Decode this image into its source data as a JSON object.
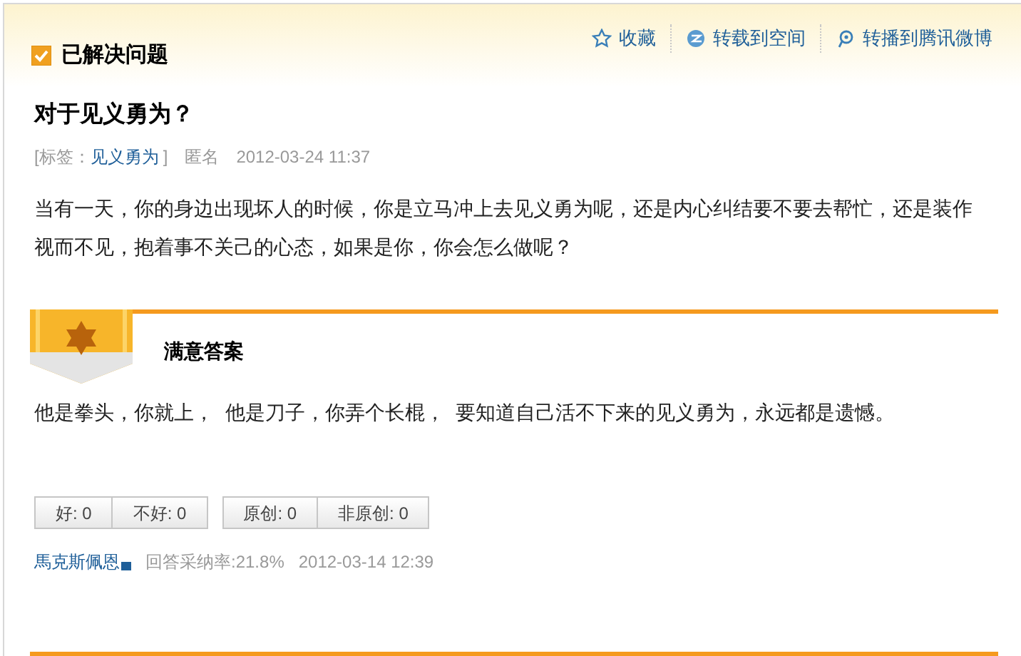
{
  "header": {
    "status_label": "已解决问题",
    "checked": true
  },
  "actions": [
    {
      "kind": "star",
      "label": "收藏"
    },
    {
      "kind": "share",
      "label": "转载到空间"
    },
    {
      "kind": "weibo",
      "label": "转播到腾讯微博"
    }
  ],
  "question": {
    "title": "对于见义勇为？",
    "tag_prefix": "[标签：",
    "tag": "见义勇为",
    "tag_suffix": "]",
    "author": "匿名",
    "time": "2012-03-24 11:37",
    "body": "当有一天，你的身边出现坏人的时候，你是立马冲上去见义勇为呢，还是内心纠结要不要去帮忙，还是装作视而不见，抱着事不关己的心态，如果是你，你会怎么做呢？"
  },
  "answer": {
    "heading": "满意答案",
    "body": "他是拳头，你就上，  他是刀子，你弄个长棍，  要知道自己活不下来的见义勇为，永远都是遗憾。",
    "vote_groups": [
      [
        {
          "label": "好: 0"
        },
        {
          "label": "不好: 0"
        }
      ],
      [
        {
          "label": "原创: 0"
        },
        {
          "label": "非原创: 0"
        }
      ]
    ],
    "author": "馬克斯佩恩",
    "rate": "回答采纳率:21.8%",
    "time": "2012-03-14 12:39"
  }
}
